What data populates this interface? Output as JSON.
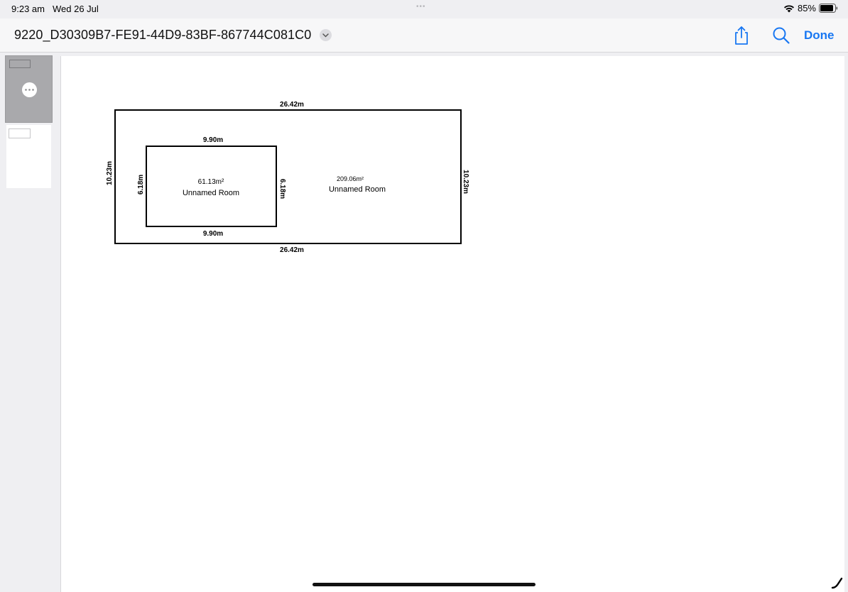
{
  "status_bar": {
    "time": "9:23 am",
    "date": "Wed 26 Jul",
    "battery": "85%"
  },
  "nav": {
    "title": "9220_D30309B7-FE91-44D9-83BF-867744C081C0",
    "done_label": "Done"
  },
  "icons": {
    "share": "share-icon",
    "search": "search-icon",
    "more": "more-icon",
    "chevron": "chevron-down-icon",
    "wifi": "wifi-icon",
    "battery": "battery-icon",
    "pencil": "pencil-icon"
  },
  "colors": {
    "accent": "#1877f2",
    "page": "#ffffff",
    "chrome": "#efeff2"
  },
  "floor_plan": {
    "outer": {
      "top": "26.42m",
      "bottom": "26.42m",
      "left": "10.23m",
      "right": "10.23m",
      "area": "209.06m²",
      "name": "Unnamed Room"
    },
    "inner": {
      "top": "9.90m",
      "bottom": "9.90m",
      "left": "6.18m",
      "right": "6.18m",
      "area": "61.13m²",
      "name": "Unnamed Room"
    }
  }
}
